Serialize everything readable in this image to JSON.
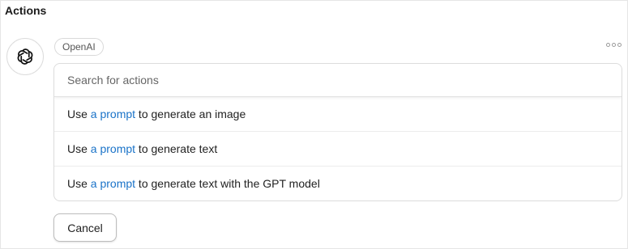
{
  "header": {
    "title": "Actions"
  },
  "provider": {
    "name": "OpenAI",
    "icon": "openai-logo-icon"
  },
  "menu": {
    "icon": "more-options-icon"
  },
  "search": {
    "placeholder": "Search for actions",
    "value": ""
  },
  "actions": [
    {
      "prefix": "Use ",
      "link": "a prompt",
      "suffix": " to generate an image"
    },
    {
      "prefix": "Use ",
      "link": "a prompt",
      "suffix": " to generate text"
    },
    {
      "prefix": "Use ",
      "link": "a prompt",
      "suffix": " to generate text with the GPT model"
    }
  ],
  "footer": {
    "cancel_label": "Cancel"
  },
  "colors": {
    "link": "#1a73c8",
    "border": "#dcdcdc"
  }
}
